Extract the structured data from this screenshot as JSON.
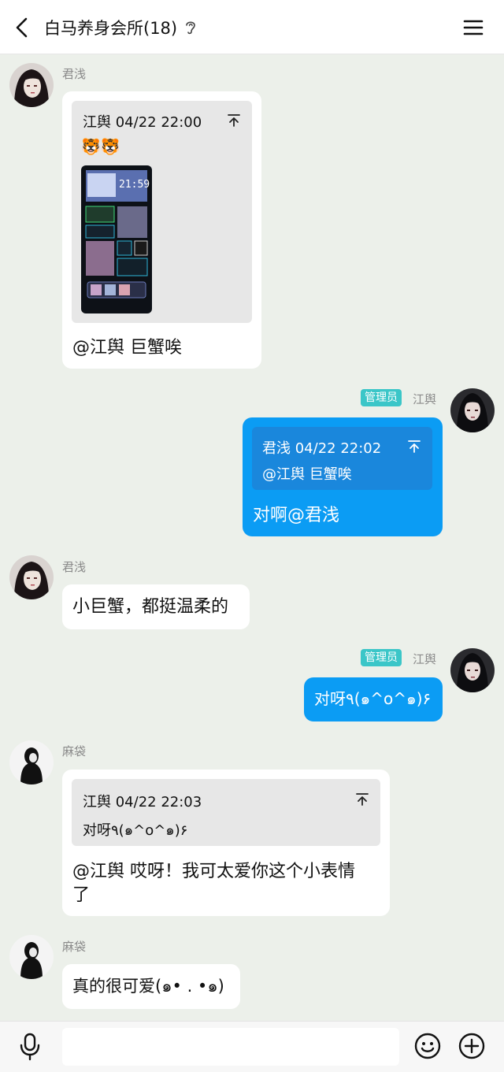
{
  "header": {
    "title": "白马养身会所(18)",
    "back_icon": "chevron-left-icon",
    "ear_icon": "ear-icon",
    "menu_icon": "hamburger-menu-icon"
  },
  "colors": {
    "background": "#ecf0ea",
    "outgoing_bubble": "#0b9cf4",
    "incoming_bubble": "#ffffff",
    "admin_badge": "#3bc6c8"
  },
  "messages": [
    {
      "sender": "君浅",
      "direction": "incoming",
      "quote": {
        "meta": "江舆 04/22 22:00",
        "emoji": "🐯🐯",
        "image": "phone-screenshot"
      },
      "text": "@江舆 巨蟹唉"
    },
    {
      "sender": "江舆",
      "role": "管理员",
      "direction": "outgoing",
      "quote": {
        "meta": "君浅 04/22 22:02",
        "text": "@江舆 巨蟹唉"
      },
      "text": "对啊@君浅"
    },
    {
      "sender": "君浅",
      "direction": "incoming",
      "text": "小巨蟹，都挺温柔的"
    },
    {
      "sender": "江舆",
      "role": "管理员",
      "direction": "outgoing",
      "text": "对呀٩(๑^o^๑)۶"
    },
    {
      "sender": "麻袋",
      "direction": "incoming",
      "quote": {
        "meta": "江舆 04/22 22:03",
        "text": "对呀٩(๑^o^๑)۶"
      },
      "text_line1": "@江舆 哎呀！我可太爱你这个小表情",
      "text_line2": "了"
    },
    {
      "sender": "麻袋",
      "direction": "incoming",
      "text": "真的很可爱(๑• . •๑)"
    }
  ],
  "input_bar": {
    "placeholder": "",
    "mic_icon": "microphone-icon",
    "emoji_icon": "smiley-icon",
    "plus_icon": "plus-circle-icon"
  }
}
